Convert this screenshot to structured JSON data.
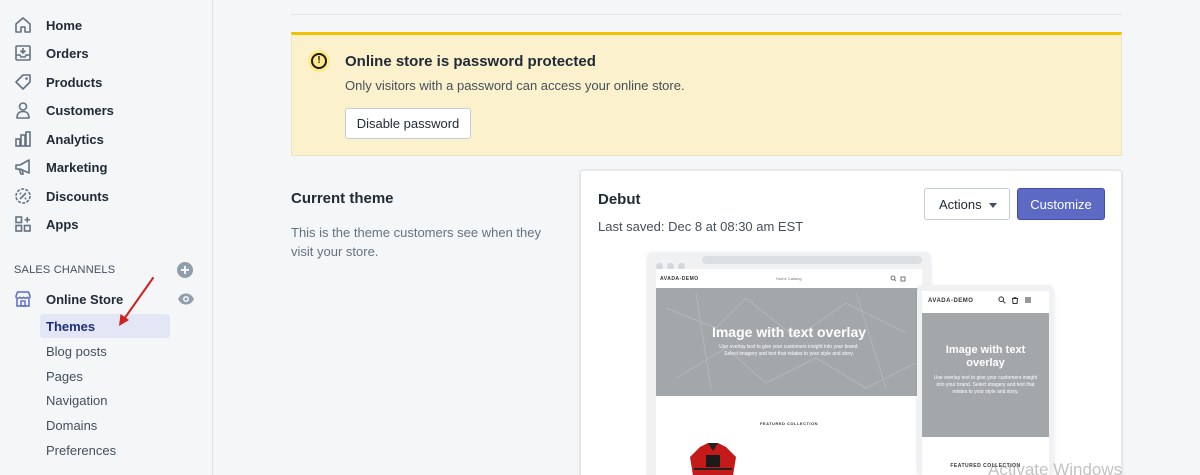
{
  "sidebar": {
    "items": [
      {
        "label": "Home",
        "icon": "home-icon"
      },
      {
        "label": "Orders",
        "icon": "orders-icon"
      },
      {
        "label": "Products",
        "icon": "tag-icon"
      },
      {
        "label": "Customers",
        "icon": "person-icon"
      },
      {
        "label": "Analytics",
        "icon": "bar-chart-icon"
      },
      {
        "label": "Marketing",
        "icon": "megaphone-icon"
      },
      {
        "label": "Discounts",
        "icon": "discount-icon"
      },
      {
        "label": "Apps",
        "icon": "apps-icon"
      }
    ],
    "sales_channels_heading": "SALES CHANNELS",
    "online_store": {
      "label": "Online Store",
      "icon": "store-icon"
    },
    "sub_items": [
      {
        "label": "Themes",
        "active": true
      },
      {
        "label": "Blog posts",
        "active": false
      },
      {
        "label": "Pages",
        "active": false
      },
      {
        "label": "Navigation",
        "active": false
      },
      {
        "label": "Domains",
        "active": false
      },
      {
        "label": "Preferences",
        "active": false
      }
    ]
  },
  "banner": {
    "title": "Online store is password protected",
    "description": "Only visitors with a password can access your online store.",
    "button_label": "Disable password"
  },
  "current_theme": {
    "heading": "Current theme",
    "description": "This is the theme customers see when they visit your store."
  },
  "theme_card": {
    "name": "Debut",
    "last_saved": "Last saved: Dec 8 at 08:30 am EST",
    "actions_label": "Actions",
    "customize_label": "Customize",
    "preview": {
      "store_name": "AVADA-DEMO",
      "menu": "Home   Catalog",
      "hero_title": "Image with text overlay",
      "hero_subtitle": "Use overlay text to give your customers insight into your brand. Select imagery and text that relates to your style and story.",
      "featured": "FEATURED COLLECTION"
    }
  },
  "watermark": "Activate Windows",
  "colors": {
    "accent": "#5c6ac4",
    "banner_bg": "#fcf1cd",
    "banner_border": "#eec200",
    "annotation_arrow": "#d0201f"
  }
}
